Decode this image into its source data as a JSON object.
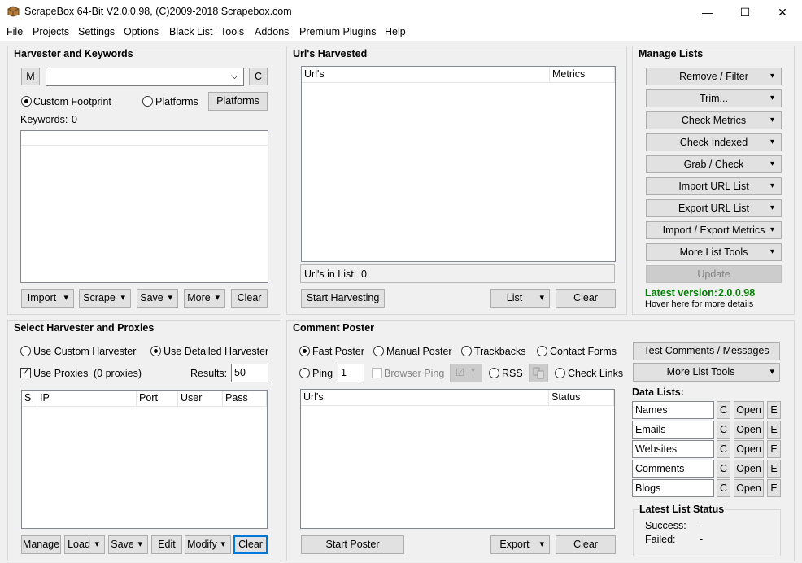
{
  "window": {
    "title": "ScrapeBox 64-Bit V2.0.0.98, (C)2009-2018 Scrapebox.com",
    "minimize": "—",
    "maximize": "☐",
    "close": "✕"
  },
  "menu": [
    "File",
    "Projects",
    "Settings",
    "Options",
    "Black List",
    "Tools",
    "Addons",
    "Premium Plugins",
    "Help"
  ],
  "harvester": {
    "title": "Harvester and Keywords",
    "m_label": "M",
    "c_label": "C",
    "keyword_combo_value": "",
    "custom_footprint": "Custom Footprint",
    "platforms_radio": "Platforms",
    "platforms_button": "Platforms",
    "keywords_label": "Keywords:",
    "keywords_count": "0",
    "buttons": {
      "import": "Import",
      "scrape": "Scrape",
      "save": "Save",
      "more": "More",
      "clear": "Clear"
    }
  },
  "urls": {
    "title": "Url's Harvested",
    "col_urls": "Url's",
    "col_metrics": "Metrics",
    "in_list_label": "Url's in List:",
    "in_list_count": "0",
    "start_harvesting": "Start Harvesting",
    "list": "List",
    "clear": "Clear"
  },
  "manage": {
    "title": "Manage Lists",
    "buttons": [
      "Remove / Filter",
      "Trim...",
      "Check Metrics",
      "Check Indexed",
      "Grab / Check",
      "Import URL List",
      "Export URL List",
      "Import / Export Metrics",
      "More List Tools"
    ],
    "update": "Update",
    "latest_version_label": "Latest version:",
    "latest_version": "2.0.0.98",
    "hover_text": "Hover here for more details"
  },
  "proxies": {
    "title": "Select Harvester and Proxies",
    "use_custom": "Use Custom Harvester",
    "use_detailed": "Use Detailed Harvester",
    "use_proxies": "Use Proxies",
    "proxies_count": "(0 proxies)",
    "results_label": "Results:",
    "results_value": "50",
    "cols": [
      "S",
      "IP",
      "Port",
      "User",
      "Pass"
    ],
    "buttons": {
      "manage": "Manage",
      "load": "Load",
      "save": "Save",
      "edit": "Edit",
      "modify": "Modify",
      "clear": "Clear"
    }
  },
  "poster": {
    "title": "Comment Poster",
    "fast": "Fast Poster",
    "manual": "Manual Poster",
    "trackbacks": "Trackbacks",
    "contact": "Contact Forms",
    "ping": "Ping",
    "ping_value": "1",
    "browser_ping": "Browser Ping",
    "rss": "RSS",
    "check_links": "Check Links",
    "col_url": "Url's",
    "col_status": "Status",
    "start_poster": "Start Poster",
    "export": "Export",
    "clear": "Clear"
  },
  "right_tools": {
    "test_comments": "Test Comments / Messages",
    "more_list_tools": "More List Tools",
    "data_lists_label": "Data Lists:",
    "data_lists": [
      "Names",
      "Emails",
      "Websites",
      "Comments",
      "Blogs"
    ],
    "c_label": "C",
    "open_label": "Open",
    "e_label": "E",
    "status_title": "Latest List Status",
    "success_label": "Success:",
    "success_value": "-",
    "failed_label": "Failed:",
    "failed_value": "-"
  },
  "colors": {
    "version_green": "#008000",
    "focus_blue": "#0078d7"
  },
  "icons": {
    "app": "box-icon",
    "dropdown": "chevron-down-icon"
  }
}
